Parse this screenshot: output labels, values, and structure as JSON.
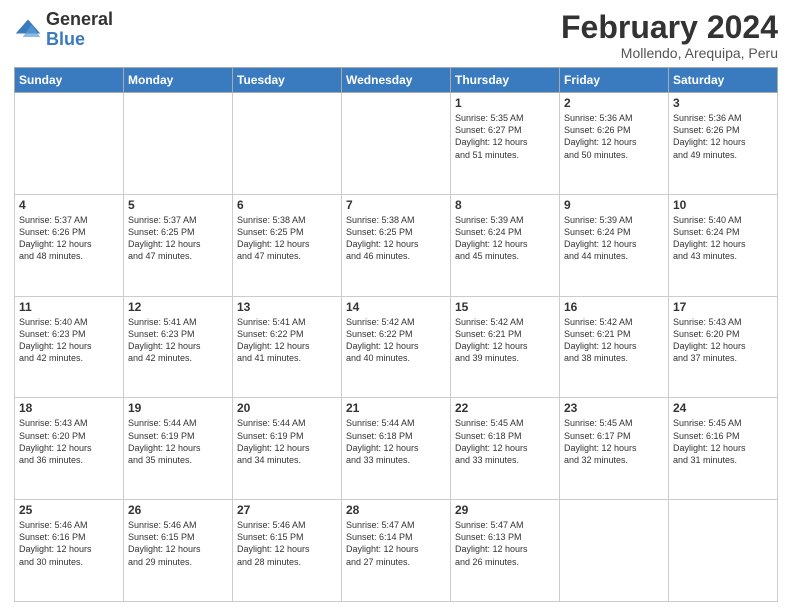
{
  "logo": {
    "general": "General",
    "blue": "Blue"
  },
  "header": {
    "title": "February 2024",
    "subtitle": "Mollendo, Arequipa, Peru"
  },
  "weekdays": [
    "Sunday",
    "Monday",
    "Tuesday",
    "Wednesday",
    "Thursday",
    "Friday",
    "Saturday"
  ],
  "weeks": [
    [
      {
        "day": "",
        "info": ""
      },
      {
        "day": "",
        "info": ""
      },
      {
        "day": "",
        "info": ""
      },
      {
        "day": "",
        "info": ""
      },
      {
        "day": "1",
        "info": "Sunrise: 5:35 AM\nSunset: 6:27 PM\nDaylight: 12 hours\nand 51 minutes."
      },
      {
        "day": "2",
        "info": "Sunrise: 5:36 AM\nSunset: 6:26 PM\nDaylight: 12 hours\nand 50 minutes."
      },
      {
        "day": "3",
        "info": "Sunrise: 5:36 AM\nSunset: 6:26 PM\nDaylight: 12 hours\nand 49 minutes."
      }
    ],
    [
      {
        "day": "4",
        "info": "Sunrise: 5:37 AM\nSunset: 6:26 PM\nDaylight: 12 hours\nand 48 minutes."
      },
      {
        "day": "5",
        "info": "Sunrise: 5:37 AM\nSunset: 6:25 PM\nDaylight: 12 hours\nand 47 minutes."
      },
      {
        "day": "6",
        "info": "Sunrise: 5:38 AM\nSunset: 6:25 PM\nDaylight: 12 hours\nand 47 minutes."
      },
      {
        "day": "7",
        "info": "Sunrise: 5:38 AM\nSunset: 6:25 PM\nDaylight: 12 hours\nand 46 minutes."
      },
      {
        "day": "8",
        "info": "Sunrise: 5:39 AM\nSunset: 6:24 PM\nDaylight: 12 hours\nand 45 minutes."
      },
      {
        "day": "9",
        "info": "Sunrise: 5:39 AM\nSunset: 6:24 PM\nDaylight: 12 hours\nand 44 minutes."
      },
      {
        "day": "10",
        "info": "Sunrise: 5:40 AM\nSunset: 6:24 PM\nDaylight: 12 hours\nand 43 minutes."
      }
    ],
    [
      {
        "day": "11",
        "info": "Sunrise: 5:40 AM\nSunset: 6:23 PM\nDaylight: 12 hours\nand 42 minutes."
      },
      {
        "day": "12",
        "info": "Sunrise: 5:41 AM\nSunset: 6:23 PM\nDaylight: 12 hours\nand 42 minutes."
      },
      {
        "day": "13",
        "info": "Sunrise: 5:41 AM\nSunset: 6:22 PM\nDaylight: 12 hours\nand 41 minutes."
      },
      {
        "day": "14",
        "info": "Sunrise: 5:42 AM\nSunset: 6:22 PM\nDaylight: 12 hours\nand 40 minutes."
      },
      {
        "day": "15",
        "info": "Sunrise: 5:42 AM\nSunset: 6:21 PM\nDaylight: 12 hours\nand 39 minutes."
      },
      {
        "day": "16",
        "info": "Sunrise: 5:42 AM\nSunset: 6:21 PM\nDaylight: 12 hours\nand 38 minutes."
      },
      {
        "day": "17",
        "info": "Sunrise: 5:43 AM\nSunset: 6:20 PM\nDaylight: 12 hours\nand 37 minutes."
      }
    ],
    [
      {
        "day": "18",
        "info": "Sunrise: 5:43 AM\nSunset: 6:20 PM\nDaylight: 12 hours\nand 36 minutes."
      },
      {
        "day": "19",
        "info": "Sunrise: 5:44 AM\nSunset: 6:19 PM\nDaylight: 12 hours\nand 35 minutes."
      },
      {
        "day": "20",
        "info": "Sunrise: 5:44 AM\nSunset: 6:19 PM\nDaylight: 12 hours\nand 34 minutes."
      },
      {
        "day": "21",
        "info": "Sunrise: 5:44 AM\nSunset: 6:18 PM\nDaylight: 12 hours\nand 33 minutes."
      },
      {
        "day": "22",
        "info": "Sunrise: 5:45 AM\nSunset: 6:18 PM\nDaylight: 12 hours\nand 33 minutes."
      },
      {
        "day": "23",
        "info": "Sunrise: 5:45 AM\nSunset: 6:17 PM\nDaylight: 12 hours\nand 32 minutes."
      },
      {
        "day": "24",
        "info": "Sunrise: 5:45 AM\nSunset: 6:16 PM\nDaylight: 12 hours\nand 31 minutes."
      }
    ],
    [
      {
        "day": "25",
        "info": "Sunrise: 5:46 AM\nSunset: 6:16 PM\nDaylight: 12 hours\nand 30 minutes."
      },
      {
        "day": "26",
        "info": "Sunrise: 5:46 AM\nSunset: 6:15 PM\nDaylight: 12 hours\nand 29 minutes."
      },
      {
        "day": "27",
        "info": "Sunrise: 5:46 AM\nSunset: 6:15 PM\nDaylight: 12 hours\nand 28 minutes."
      },
      {
        "day": "28",
        "info": "Sunrise: 5:47 AM\nSunset: 6:14 PM\nDaylight: 12 hours\nand 27 minutes."
      },
      {
        "day": "29",
        "info": "Sunrise: 5:47 AM\nSunset: 6:13 PM\nDaylight: 12 hours\nand 26 minutes."
      },
      {
        "day": "",
        "info": ""
      },
      {
        "day": "",
        "info": ""
      }
    ]
  ]
}
